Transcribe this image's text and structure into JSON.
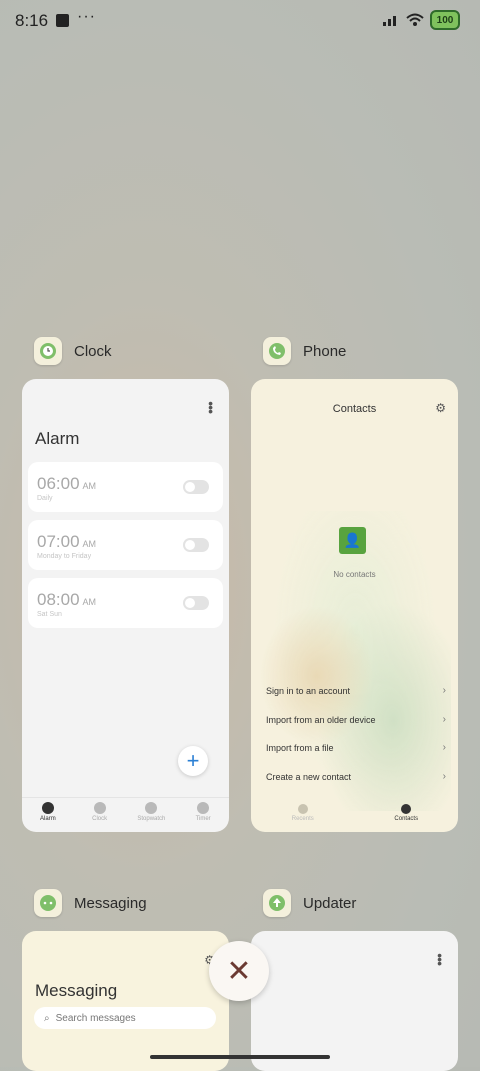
{
  "status_bar": {
    "time": "8:16",
    "more": "···",
    "battery": "100"
  },
  "recents": [
    {
      "app_name": "Clock"
    },
    {
      "app_name": "Phone"
    },
    {
      "app_name": "Messaging"
    },
    {
      "app_name": "Updater"
    }
  ],
  "clock": {
    "title": "Alarm",
    "alarms": [
      {
        "time": "06:00",
        "ampm": "AM",
        "repeat": "Daily",
        "enabled": false
      },
      {
        "time": "07:00",
        "ampm": "AM",
        "repeat": "Monday to Friday",
        "enabled": false
      },
      {
        "time": "08:00",
        "ampm": "AM",
        "repeat": "Sat Sun",
        "enabled": false
      }
    ],
    "fab": "+",
    "tabs": [
      "Alarm",
      "Clock",
      "Stopwatch",
      "Timer"
    ]
  },
  "phone": {
    "title": "Contacts",
    "empty": "No contacts",
    "options": [
      "Sign in to an account",
      "Import from an older device",
      "Import from a file",
      "Create a new contact"
    ],
    "tabs": [
      "Recents",
      "Contacts"
    ]
  },
  "messaging": {
    "title": "Messaging",
    "search_placeholder": "Search messages"
  },
  "close_label": "✕"
}
